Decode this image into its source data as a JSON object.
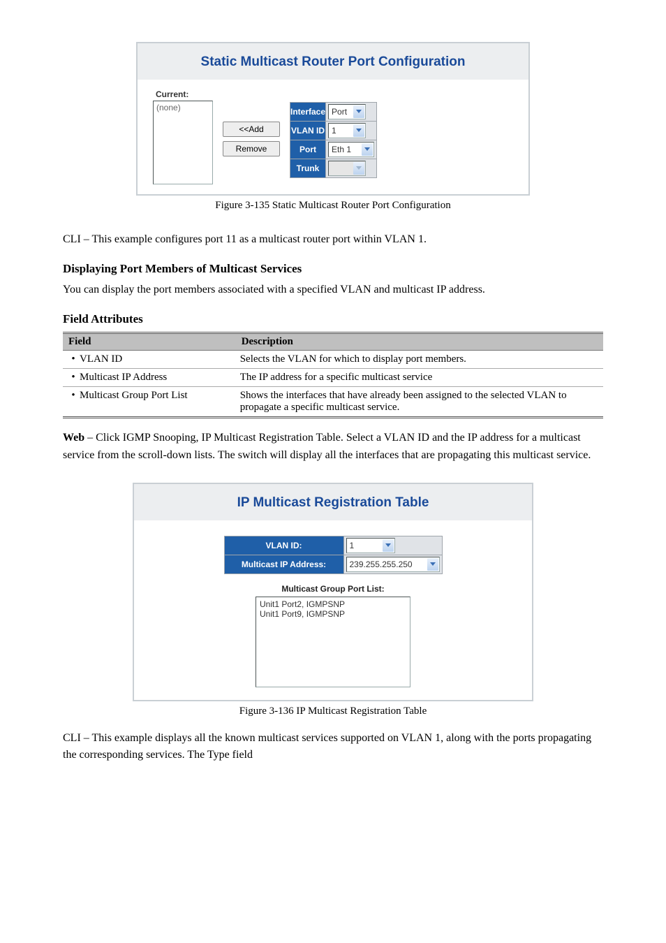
{
  "fig1": {
    "title": "Static Multicast Router Port Configuration",
    "current_label": "Current:",
    "current_value": "(none)",
    "add_btn": "<<Add",
    "remove_btn": "Remove",
    "rows": {
      "interface": {
        "label": "Interface",
        "value": "Port"
      },
      "vlan": {
        "label": "VLAN ID",
        "value": "1"
      },
      "port": {
        "label": "Port",
        "value": "Eth 1"
      },
      "trunk": {
        "label": "Trunk",
        "value": ""
      }
    },
    "caption": "Figure 3-135  Static Multicast Router Port Configuration"
  },
  "cli_intro": "CLI – This example configures port 11 as a multicast router port within VLAN 1.",
  "section1_heading": "Displaying Port Members of Multicast Services",
  "resume_intro": "You can display the port members associated with a specified VLAN and multicast IP address.",
  "field_table": {
    "h1": "Field",
    "h2": "Description",
    "rows": [
      {
        "field": "VLAN ID",
        "desc": "Selects the VLAN for which to display port members."
      },
      {
        "field": "Multicast IP Address",
        "desc": "The IP address for a specific multicast service"
      },
      {
        "field": "Multicast Group Port List",
        "desc": "Shows the interfaces that have already been assigned to the selected VLAN to propagate a specific multicast service."
      }
    ]
  },
  "resume": {
    "prefix_bold": "Web",
    "text": " – Click IGMP Snooping, IP Multicast Registration Table. Select a VLAN ID and the IP address for a multicast service from the scroll-down lists. The switch will display all the interfaces that are propagating this multicast service."
  },
  "fig2": {
    "title": "IP Multicast Registration Table",
    "vlan_label": "VLAN ID:",
    "vlan_value": "1",
    "mip_label": "Multicast IP Address:",
    "mip_value": "239.255.255.250",
    "list_label": "Multicast Group Port List:",
    "list_items": [
      "Unit1 Port2, IGMPSNP",
      "Unit1 Port9, IGMPSNP"
    ],
    "caption": "Figure 3-136  IP Multicast Registration Table"
  },
  "cli_outro": "CLI – This example displays all the known multicast services supported on VLAN 1, along with the ports propagating the corresponding services. The Type field",
  "field_attr": "Field Attributes",
  "chart_data": null
}
